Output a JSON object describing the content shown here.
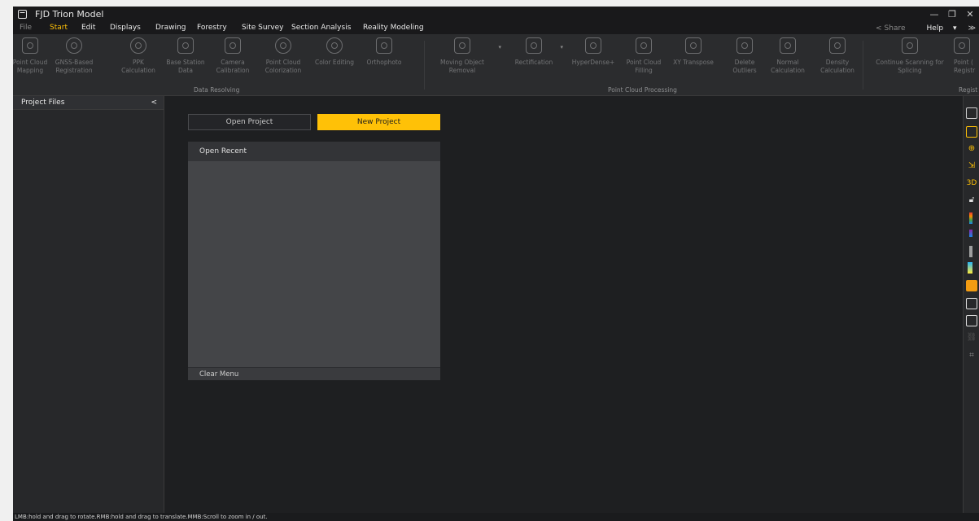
{
  "window": {
    "title": "FJD Trion Model",
    "minimize": "—",
    "restore": "❐",
    "close": "✕"
  },
  "menubar": {
    "items": [
      "File",
      "Start",
      "Edit",
      "Displays",
      "Drawing",
      "Forestry",
      "Site Survey",
      "Section Analysis",
      "Reality Modeling"
    ],
    "share": "Share",
    "help": "Help",
    "dropdown": "▾",
    "collapse": "≫"
  },
  "ribbon": {
    "groups": {
      "data_resolving": "Data Resolving",
      "point_cloud_processing": "Point Cloud Processing",
      "registration": "Regist"
    },
    "tools": [
      {
        "l1": "Point Cloud",
        "l2": "Mapping"
      },
      {
        "l1": "GNSS-Based",
        "l2": "Registration"
      },
      {
        "l1": "PPK",
        "l2": "Calculation"
      },
      {
        "l1": "Base Station",
        "l2": "Data"
      },
      {
        "l1": "Camera",
        "l2": "Calibration"
      },
      {
        "l1": "Point Cloud",
        "l2": "Colorization"
      },
      {
        "l1": "Color Editing",
        "l2": ""
      },
      {
        "l1": "Orthophoto",
        "l2": ""
      },
      {
        "l1": "Moving Object",
        "l2": "Removal"
      },
      {
        "l1": "Rectification",
        "l2": ""
      },
      {
        "l1": "HyperDense+",
        "l2": ""
      },
      {
        "l1": "Point Cloud",
        "l2": "Filling"
      },
      {
        "l1": "XY Transpose",
        "l2": ""
      },
      {
        "l1": "Delete",
        "l2": "Outliers"
      },
      {
        "l1": "Normal",
        "l2": "Calculation"
      },
      {
        "l1": "Density",
        "l2": "Calculation"
      },
      {
        "l1": "Continue Scanning for",
        "l2": "Splicing"
      },
      {
        "l1": "Point (",
        "l2": "Registr"
      }
    ]
  },
  "left_panel": {
    "title": "Project Files",
    "collapse": "<"
  },
  "main": {
    "open_project": "Open Project",
    "new_project": "New Project",
    "open_recent": "Open Recent",
    "clear_menu": "Clear Menu"
  },
  "right_toolbar": {
    "label_3d": "3D"
  },
  "status": "LMB:hold and drag to rotate.RMB:hold and drag to translate.MMB:Scroll to zoom in / out.",
  "colors": {
    "accent": "#ffc107",
    "background": "#1e1f21",
    "panel": "#27282a"
  }
}
